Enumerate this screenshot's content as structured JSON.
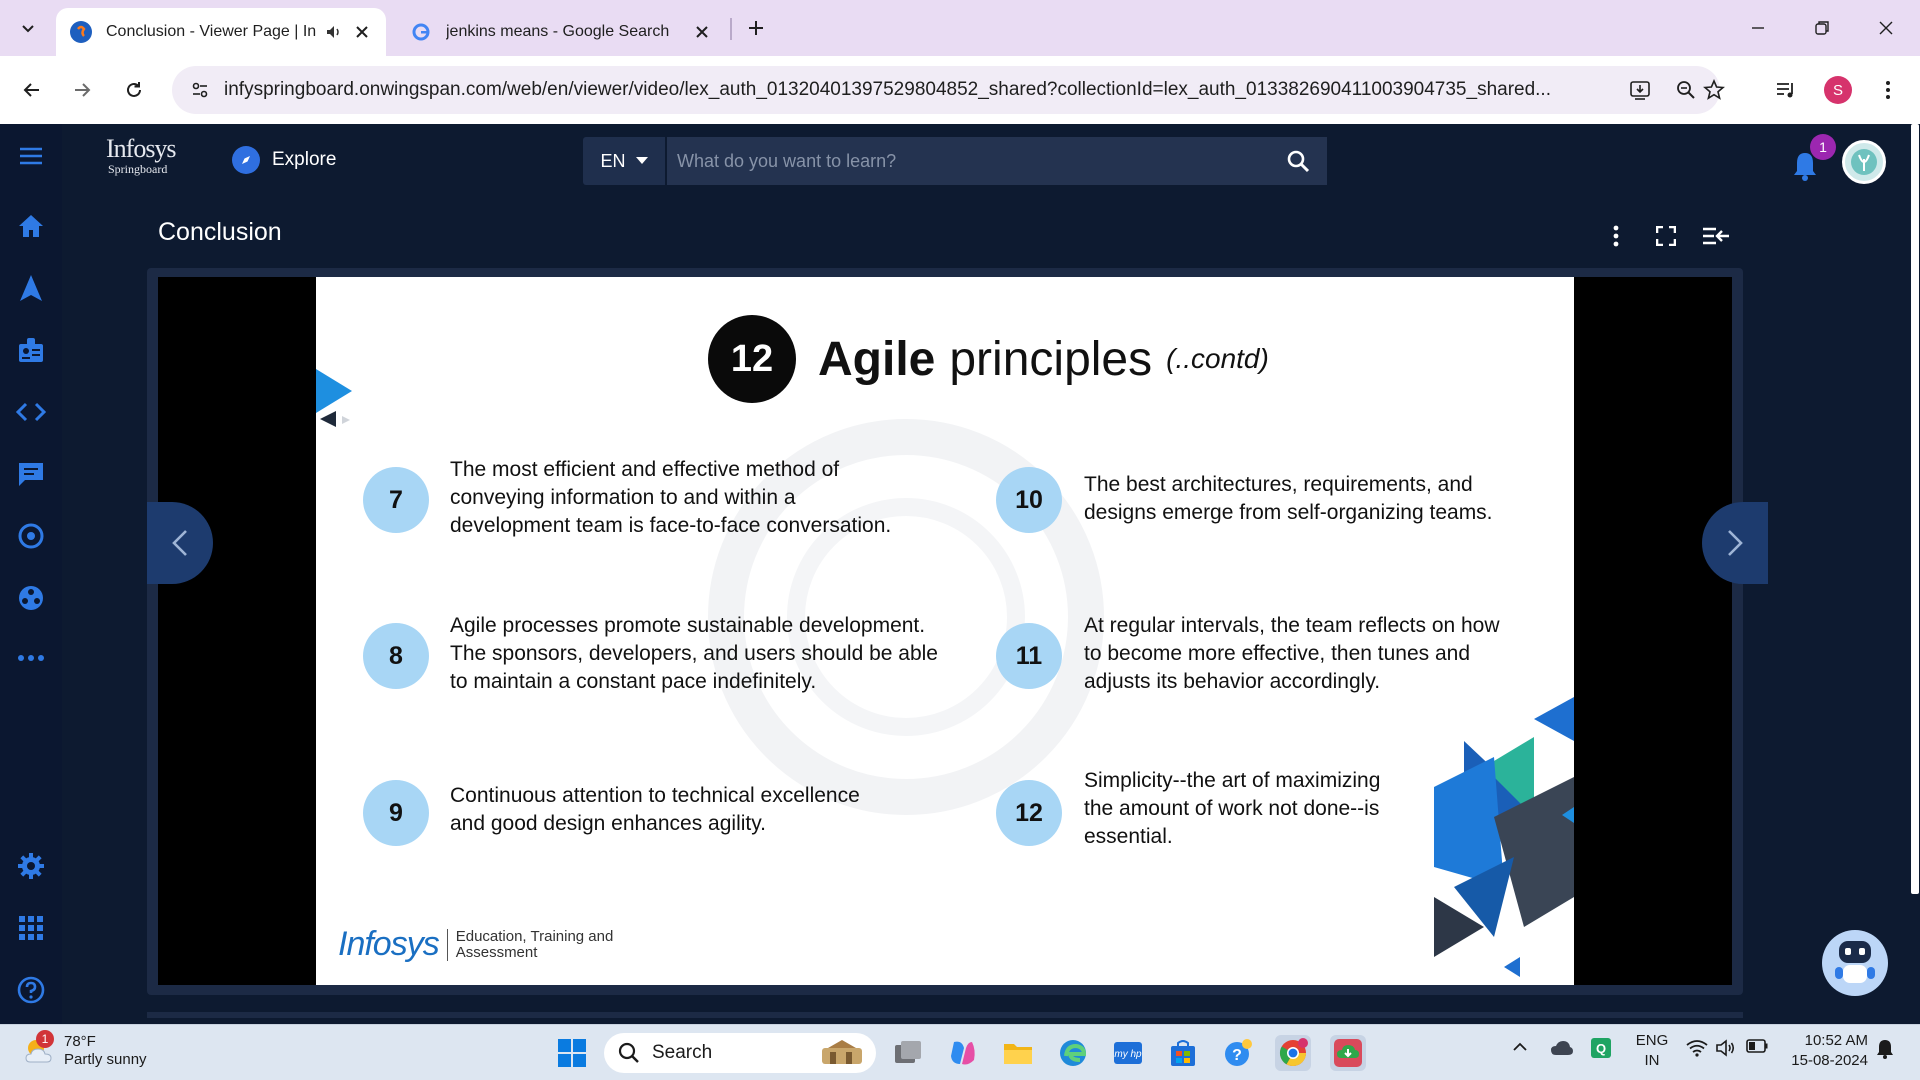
{
  "browser": {
    "tabs": [
      {
        "title": "Conclusion - Viewer Page | Infosys Springboard",
        "active": true
      },
      {
        "title": "jenkins means - Google Search",
        "active": false
      }
    ],
    "url": "infyspringboard.onwingspan.com/web/en/viewer/video/lex_auth_01320401397529804852_shared?collectionId=lex_auth_01338269041100390473​5_shared...",
    "profile_initial": "S"
  },
  "app": {
    "logo_line1": "Infosys",
    "logo_line2": "Springboard",
    "explore_label": "Explore",
    "language": "EN",
    "search_placeholder": "What do you want to learn?",
    "notification_count": "1",
    "page_title": "Conclusion"
  },
  "slide": {
    "number": "12",
    "title_bold": "Agile",
    "title_rest": "principles",
    "title_suffix": "(..contd)",
    "principles": [
      {
        "num": "7",
        "text": "The most efficient and effective method of\nconveying information to and within a\ndevelopment team is face-to-face conversation."
      },
      {
        "num": "8",
        "text": "Agile processes promote sustainable development.\nThe sponsors, developers, and users should be able\nto maintain a constant pace indefinitely."
      },
      {
        "num": "9",
        "text": "Continuous attention to technical excellence\nand good design enhances agility."
      },
      {
        "num": "10",
        "text": "The best architectures, requirements, and\ndesigns emerge from self-organizing teams."
      },
      {
        "num": "11",
        "text": "At regular intervals, the team reflects on how\nto become more effective, then tunes and\nadjusts its behavior accordingly."
      },
      {
        "num": "12",
        "text": "Simplicity--the art of maximizing\nthe amount of work not done--is\nessential."
      }
    ],
    "footer_brand": "Infosys",
    "footer_text": "Education, Training and\nAssessment"
  },
  "taskbar": {
    "weather_temp": "78°F",
    "weather_desc": "Partly sunny",
    "weather_badge": "1",
    "search_label": "Search",
    "lang_line1": "ENG",
    "lang_line2": "IN",
    "time": "10:52 AM",
    "date": "15-08-2024"
  },
  "colors": {
    "accent": "#2f6fe0",
    "principle_circle": "#a8d6f5",
    "app_bg": "#0d1a30"
  }
}
